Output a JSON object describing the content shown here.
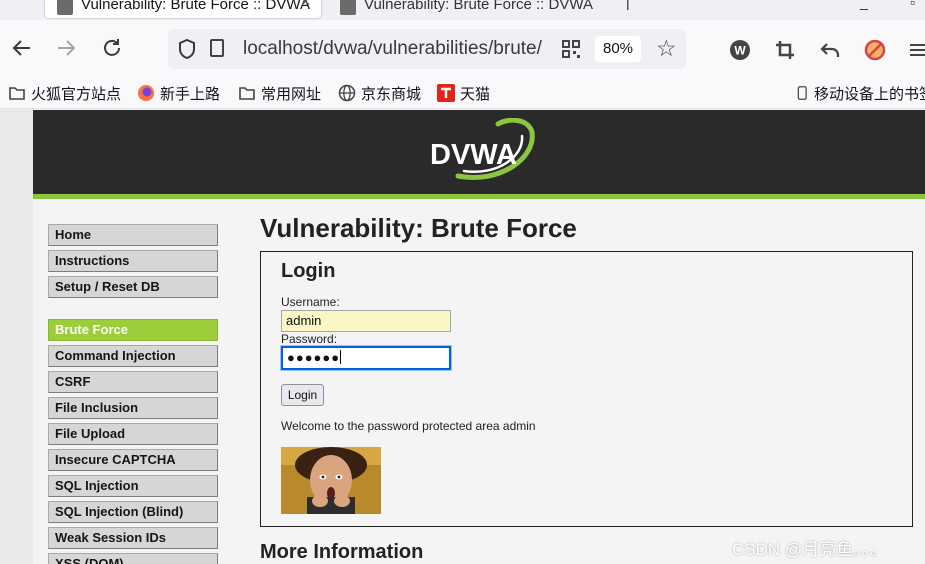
{
  "browser": {
    "tabs": [
      {
        "title": "Vulnerability: Brute Force :: DVWA",
        "active": true
      },
      {
        "title": "Vulnerability: Brute Force :: DVWA",
        "active": false
      }
    ],
    "url": "localhost/dvwa/vulnerabilities/brute/",
    "zoom": "80%",
    "bookmarks": [
      {
        "label": "火狐官方站点",
        "icon": "folder-icon"
      },
      {
        "label": "新手上路",
        "icon": "firefox-icon"
      },
      {
        "label": "常用网址",
        "icon": "folder-icon"
      },
      {
        "label": "京东商城",
        "icon": "globe-icon"
      },
      {
        "label": "天猫",
        "icon": "tmall-icon"
      }
    ],
    "mobile_bookmarks": "移动设备上的书签"
  },
  "dvwa": {
    "logo_text": "DVWA",
    "menu_group1": [
      "Home",
      "Instructions",
      "Setup / Reset DB"
    ],
    "menu_group2": [
      "Brute Force",
      "Command Injection",
      "CSRF",
      "File Inclusion",
      "File Upload",
      "Insecure CAPTCHA",
      "SQL Injection",
      "SQL Injection (Blind)",
      "Weak Session IDs",
      "XSS (DOM)"
    ],
    "selected_item": "Brute Force",
    "page_title": "Vulnerability: Brute Force",
    "login": {
      "heading": "Login",
      "username_label": "Username:",
      "username_value": "admin",
      "password_label": "Password:",
      "password_value": "●●●●●●",
      "button": "Login",
      "welcome": "Welcome to the password protected area admin"
    },
    "more_info": "More Information"
  },
  "watermark": "CSDN @月亮鱼。。。",
  "colors": {
    "accent": "#9ccd3a",
    "header_bg": "#2a2a2a",
    "header_stripe": "#8cc63f"
  }
}
